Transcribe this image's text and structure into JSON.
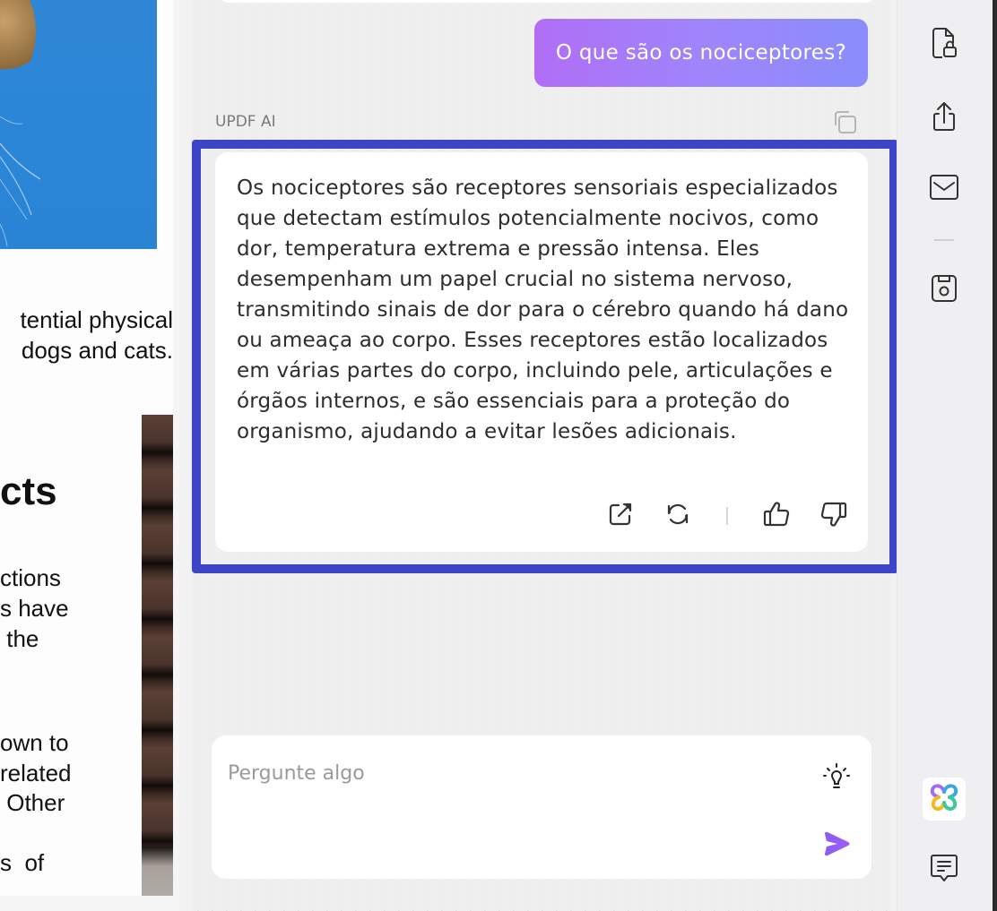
{
  "document": {
    "lines_right_aligned": [
      "tential physical",
      "dogs and cats."
    ],
    "heading_fragment": "cts",
    "paragraph_fragments_1": [
      "ctions",
      "s  have",
      " the"
    ],
    "paragraph_fragments_2": [
      "own to",
      "related",
      " Other"
    ],
    "paragraph_fragments_3": [
      "s  of"
    ]
  },
  "chat": {
    "user_message": "O que são os nociceptores?",
    "ai_label": "UPDF AI",
    "ai_response": "Os nociceptores são receptores sensoriais especializados que detectam estímulos potencialmente nocivos, como dor, temperatura extrema e pressão intensa. Eles desempenham um papel crucial no sistema nervoso, transmitindo sinais de dor para o cérebro quando há dano ou ameaça ao corpo. Esses receptores estão localizados em várias partes do corpo, incluindo pele, articulações e órgãos internos, e são essenciais para a proteção do organismo, ajudando a evitar lesões adicionais.",
    "actions": [
      {
        "name": "export",
        "icon": "external-link-icon"
      },
      {
        "name": "regenerate",
        "icon": "refresh-icon"
      },
      {
        "name": "like",
        "icon": "thumbs-up-icon"
      },
      {
        "name": "dislike",
        "icon": "thumbs-down-icon"
      }
    ],
    "input": {
      "value": "",
      "placeholder": "Pergunte algo"
    }
  },
  "sidebar": {
    "items": [
      {
        "name": "protect-document",
        "icon": "file-lock-icon"
      },
      {
        "name": "share",
        "icon": "share-icon"
      },
      {
        "name": "email",
        "icon": "mail-icon"
      },
      {
        "name": "save",
        "icon": "save-icon"
      },
      {
        "name": "updf-ai",
        "icon": "updf-ai-logo-icon"
      },
      {
        "name": "comments",
        "icon": "comment-icon"
      }
    ]
  },
  "colors": {
    "highlight_frame": "#3e44c8",
    "bubble_gradient_start": "#b06ef6",
    "bubble_gradient_end": "#8a8dfb",
    "send_accent": "#9a5cf5"
  }
}
